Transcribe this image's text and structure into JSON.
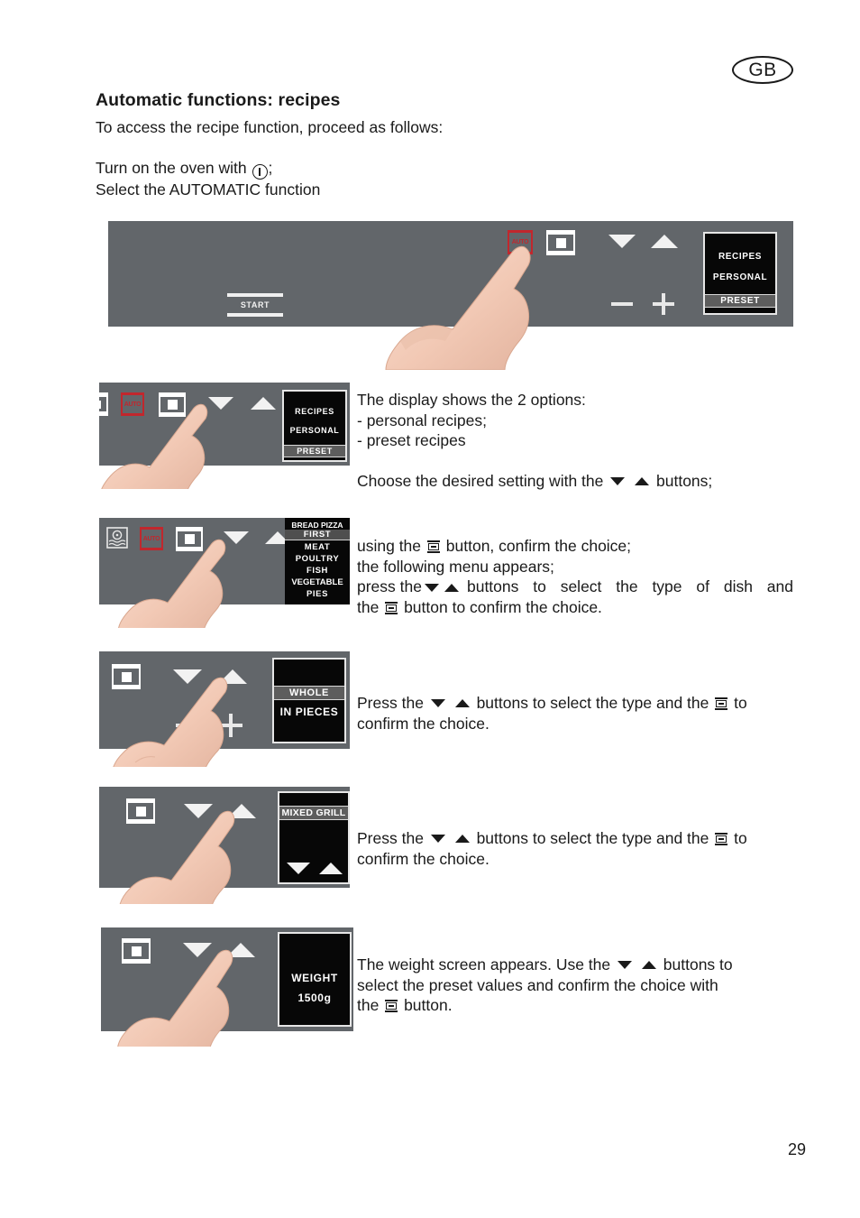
{
  "locale_badge": "GB",
  "page_number": "29",
  "heading": "Automatic functions: recipes",
  "intro": "To access the recipe function, proceed as follows:",
  "turn_on_prefix": "Turn on the oven with",
  "turn_on_suffix": ";",
  "select_auto_line": "Select the AUTOMATIC function",
  "colors": {
    "panel_grey": "#62666a",
    "lcd_black": "#070707",
    "auto_red": "#c1272d",
    "key_white": "#f2f2f2",
    "text_black": "#1a1a1a"
  },
  "panels": {
    "step1": {
      "start_label": "START",
      "auto_label": "AUTO",
      "display_rows": [
        {
          "text": "RECIPES",
          "highlight": false
        },
        {
          "text": "PERSONAL",
          "highlight": false
        },
        {
          "text": "PRESET",
          "highlight": true
        },
        {
          "text": "",
          "highlight": false
        }
      ]
    },
    "step2": {
      "auto_label": "AUTO",
      "display_rows": [
        {
          "text": "RECIPES",
          "highlight": false
        },
        {
          "text": "PERSONAL",
          "highlight": false
        },
        {
          "text": "PRESET",
          "highlight": true
        },
        {
          "text": "",
          "highlight": false
        }
      ]
    },
    "step3": {
      "auto_label": "AUTO",
      "display_rows": [
        {
          "text": "BREAD  PIZZA",
          "highlight": false
        },
        {
          "text": "FIRST",
          "highlight": true
        },
        {
          "text": "MEAT",
          "highlight": false
        },
        {
          "text": "POULTRY",
          "highlight": false
        },
        {
          "text": "FISH",
          "highlight": false
        },
        {
          "text": "VEGETABLE",
          "highlight": false
        },
        {
          "text": "PIES",
          "highlight": false
        }
      ]
    },
    "step4": {
      "display_rows": [
        {
          "text": "WHOLE",
          "highlight": true
        },
        {
          "text": "IN PIECES",
          "highlight": false
        }
      ]
    },
    "step5": {
      "display_rows": [
        {
          "text": "MIXED GRILL",
          "highlight": true
        }
      ]
    },
    "step6": {
      "display_title": "WEIGHT",
      "display_value": "1500g"
    }
  },
  "texts": {
    "step2": {
      "line1": "The display shows the 2 options:",
      "bullet1": "-  personal recipes;",
      "bullet2": "-  preset recipes",
      "line2_a": "Choose the desired setting with the",
      "line2_b": "buttons;"
    },
    "step3": {
      "line1_a": "using the",
      "line1_b": "button, confirm the choice;",
      "line2": "the following menu appears;",
      "line3_a": "press the",
      "line3_b": "buttons to select the type of dish and",
      "line4_a": "the",
      "line4_b": "button to confirm the choice."
    },
    "step4": {
      "line1_a": "Press the",
      "line1_b": "buttons to select the type and the",
      "line1_c": "to",
      "line2": "confirm the choice."
    },
    "step5": {
      "line1_a": "Press the",
      "line1_b": "buttons to select the type and the",
      "line1_c": "to",
      "line2": "confirm the choice."
    },
    "step6": {
      "line1_a": "The weight screen appears. Use the",
      "line1_b": "buttons  to",
      "line2": "select the preset values and confirm the choice with",
      "line3_a": "the",
      "line3_b": "button."
    }
  }
}
